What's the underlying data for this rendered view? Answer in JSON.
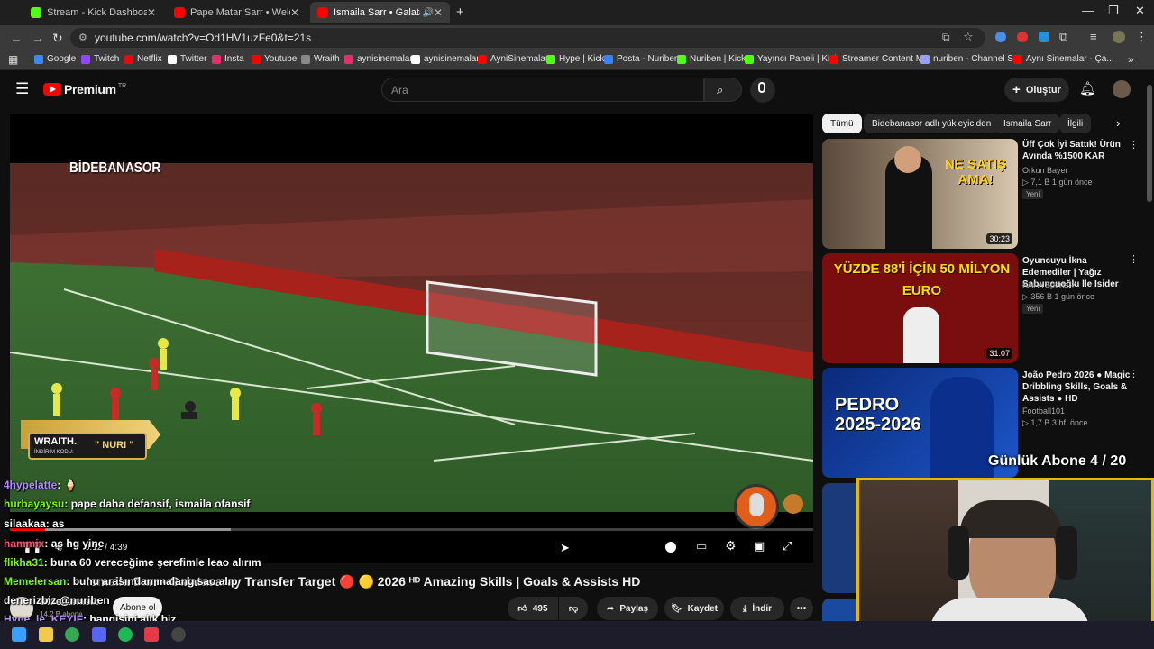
{
  "browser": {
    "tabs": [
      {
        "title": "Stream - Kick Dashboard",
        "favicon_color": "#53fc18",
        "active": false
      },
      {
        "title": "Pape Matar Sarr • Welcome to",
        "favicon_color": "#ff0000",
        "active": false
      },
      {
        "title": "Ismaila Sarr • Galatasaray T",
        "favicon_color": "#ff0000",
        "active": true
      }
    ],
    "new_tab": "+",
    "url": "youtube.com/watch?v=Od1HV1uzFe0&t=21s",
    "bookmarks": [
      {
        "label": "Google",
        "color": "#4285f4"
      },
      {
        "label": "Twitch",
        "color": "#9146ff"
      },
      {
        "label": "Netflix",
        "color": "#e50914"
      },
      {
        "label": "Twitter",
        "color": "#ffffff"
      },
      {
        "label": "Insta",
        "color": "#e1306c"
      },
      {
        "label": "Youtube",
        "color": "#ff0000"
      },
      {
        "label": "Wraith",
        "color": "#888888"
      },
      {
        "label": "aynisinemalar",
        "color": "#e1306c"
      },
      {
        "label": "aynisinemalar",
        "color": "#ffffff"
      },
      {
        "label": "AyniSinemalar",
        "color": "#ff0000"
      },
      {
        "label": "Hype | Kick",
        "color": "#53fc18"
      },
      {
        "label": "Posta - Nuriben",
        "color": "#3b82f6"
      },
      {
        "label": "Nuriben | Kick",
        "color": "#53fc18"
      },
      {
        "label": "Yayıncı Paneli | Kick",
        "color": "#53fc18"
      },
      {
        "label": "Streamer Content M...",
        "color": "#ff0000"
      },
      {
        "label": "nuriben - Channel S...",
        "color": "#9aa0ff"
      },
      {
        "label": "Aynı Sinemalar - Ça...",
        "color": "#ff0000"
      }
    ]
  },
  "youtube": {
    "logo": "Premium",
    "logo_sup": "TR",
    "search_placeholder": "Ara",
    "create_label": "Oluştur",
    "video_overlay_channel": "BİDEBANASOR",
    "sponsor_badge": {
      "brand": "WRAITH.",
      "code_label": "İNDİRİM KODU:",
      "code": "\" NURI \""
    },
    "time": "0:12 / 4:39",
    "progress_pct": 4.4,
    "video_title": "Ismaila Sarr • Galatasaray Transfer Target 🔴 🟡 2026 ᴴᴰ Amazing Skills | Goals & Assists HD",
    "channel_name": "Bidebanasor",
    "subscribers": "14,2 B abone",
    "subscribe_label": "Abone ol",
    "likes": "495",
    "share_label": "Paylaş",
    "save_label": "Kaydet",
    "download_label": "İndir"
  },
  "chips": [
    "Tümü",
    "Bidebanasor adlı yükleyiciden",
    "Ismaila Sarr",
    "İlgili"
  ],
  "recommendations": [
    {
      "title": "Üff Çok İyi Sattık! Ürün Avında %1500 KAR",
      "channel": "Orkun Bayer",
      "meta": "▷ 7,1 B   1 gün önce",
      "badge": "Yeni",
      "duration": "30:23",
      "thumb_text": "NE SATIŞ AMA!"
    },
    {
      "title": "Oyuncuyu İkna Edemediler | Yağız Sabuncuoğlu İle Isider",
      "channel": "KAFA Sports",
      "meta": "▷ 356 B   1 gün önce",
      "badge": "Yeni",
      "duration": "31:07",
      "thumb_text": "YÜZDE 88'İ İÇİN 50 MİLYON EURO"
    },
    {
      "title": "João Pedro 2026 ● Magic Dribbling Skills, Goals & Assists ● HD",
      "channel": "Football101",
      "meta": "▷ 1,7 B   3 hf. önce",
      "badge": "",
      "duration": "",
      "thumb_text": "PEDRO 2025-2026"
    }
  ],
  "stream_overlay": {
    "sub_goal": "Günlük Abone 4 / 20",
    "chat": [
      {
        "user": "4hypelatte",
        "msg": ": 🍦",
        "color": "#b48cff"
      },
      {
        "user": "hurbayaysu",
        "msg": ": pape daha defansif, ismaila ofansif",
        "color": "#7cfc00"
      },
      {
        "user": "silaakaa",
        "msg": ": as",
        "color": "#ffffff"
      },
      {
        "user": "hammix",
        "msg": ": as hg yine",
        "color": "#ff4d6d"
      },
      {
        "user": "flikha31",
        "msg": ": buna 60 vereceğime şerefimle leao alırım",
        "color": "#7cfc00"
      },
      {
        "user": "Memelersan",
        "msg": ": bunu arasından malang sao alıp",
        "color": "#7cfc00"
      },
      {
        "user": "denerizbiz",
        "msg": " @nuriben",
        "color": "#ffffff"
      },
      {
        "user": "Hype_le_KEYIF",
        "msg": ": hangisini alık biz",
        "color": "#b48cff"
      }
    ]
  }
}
